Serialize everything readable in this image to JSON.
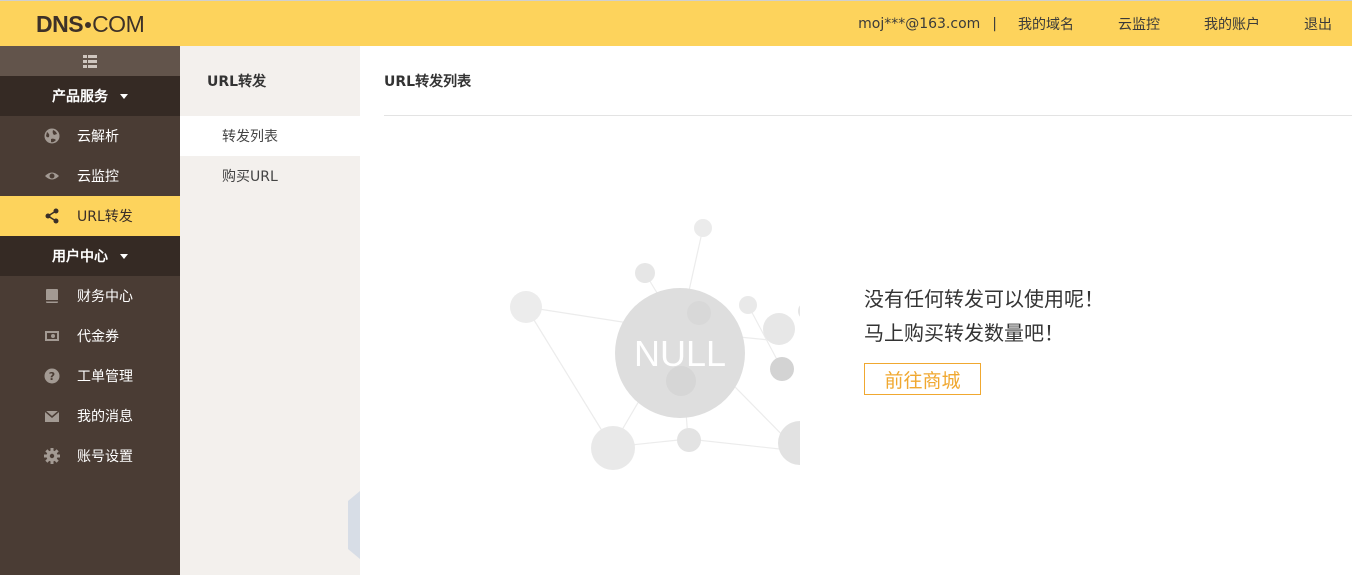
{
  "brand": {
    "logo_strong": "DNS",
    "logo_thin": "COM"
  },
  "topnav": {
    "email": "moj***@163.com",
    "separator": "|",
    "links": [
      "我的域名",
      "云监控",
      "我的账户",
      "退出"
    ]
  },
  "sidebar": {
    "toggle_icon": "grid-icon",
    "group_products": "产品服务",
    "products": [
      {
        "label": "云解析",
        "icon": "globe-icon"
      },
      {
        "label": "云监控",
        "icon": "eye-icon"
      },
      {
        "label": "URL转发",
        "icon": "share-icon",
        "active": true
      }
    ],
    "group_user": "用户中心",
    "user_items": [
      {
        "label": "财务中心",
        "icon": "book-icon"
      },
      {
        "label": "代金券",
        "icon": "coupon-icon"
      },
      {
        "label": "工单管理",
        "icon": "question-icon"
      },
      {
        "label": "我的消息",
        "icon": "mail-icon"
      },
      {
        "label": "账号设置",
        "icon": "gear-icon"
      }
    ]
  },
  "subpanel": {
    "title": "URL转发",
    "items": [
      {
        "label": "转发列表",
        "active": true
      },
      {
        "label": "购买URL"
      }
    ]
  },
  "main": {
    "title": "URL转发列表",
    "empty_art_text": "NULL",
    "empty_line1": "没有任何转发可以使用呢！",
    "empty_line2": "马上购买转发数量吧！",
    "shop_button": "前往商城"
  },
  "colors": {
    "topbar": "#fdd35c",
    "sidebar": "#4a3c34",
    "sidebar_group": "#352a24",
    "active_item": "#fdd35c",
    "accent": "#f0a830"
  }
}
